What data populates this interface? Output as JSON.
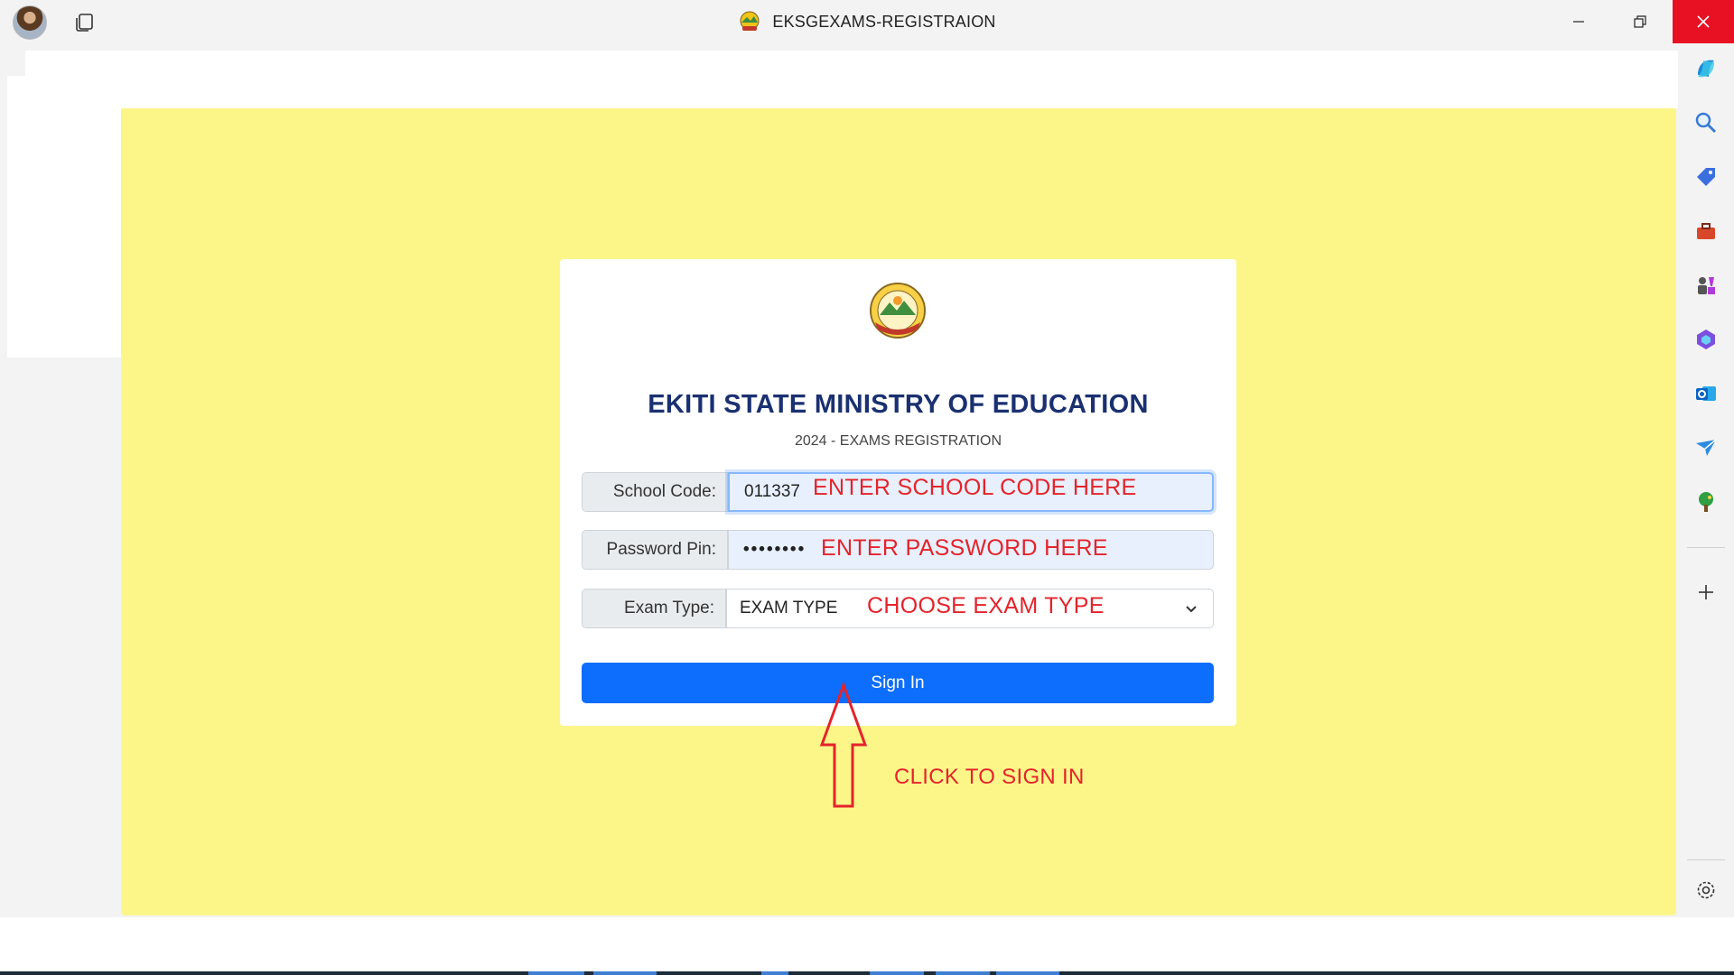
{
  "window": {
    "title": "EKSGEXAMS-REGISTRAION",
    "controls": {
      "minimize": "minimize",
      "maximize": "restore",
      "close": "close"
    }
  },
  "sidebar": {
    "icons": [
      "copilot-icon",
      "search-icon",
      "shopping-tag-icon",
      "toolbox-icon",
      "games-icon",
      "microsoft365-icon",
      "outlook-icon",
      "send-icon",
      "tree-icon",
      "add-icon",
      "settings-icon"
    ]
  },
  "card": {
    "title": "EKITI STATE MINISTRY OF EDUCATION",
    "subtitle": "2024 - EXAMS REGISTRATION",
    "school_code": {
      "label": "School Code:",
      "value": "011337",
      "note": "ENTER SCHOOL CODE HERE"
    },
    "password": {
      "label": "Password Pin:",
      "value": "••••••••",
      "note": "ENTER PASSWORD HERE"
    },
    "exam_type": {
      "label": "Exam Type:",
      "selected": "EXAM TYPE",
      "note": "CHOOSE EXAM TYPE"
    },
    "signin_label": "Sign In"
  },
  "annotation": {
    "click_note": "CLICK TO SIGN IN"
  },
  "colors": {
    "page_background": "#fcf689",
    "title_color": "#1a3071",
    "primary_button": "#0d6efd",
    "annotation_red": "#e5232b",
    "close_button": "#e81123"
  }
}
